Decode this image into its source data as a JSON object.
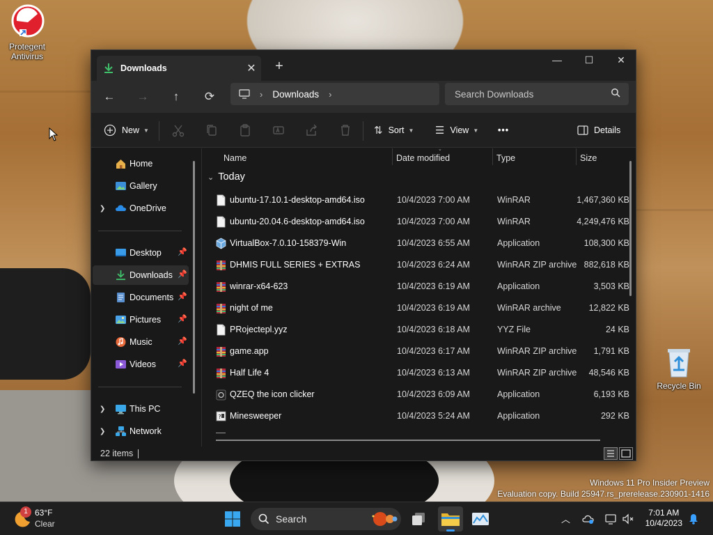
{
  "desktop": {
    "icons": [
      {
        "label": "Protegent Antivirus"
      },
      {
        "label": "Recycle Bin"
      }
    ],
    "watermark": {
      "line1": "Windows 11 Pro Insider Preview",
      "line2": "Evaluation copy. Build 25947.rs_prerelease.230901-1416"
    }
  },
  "explorer": {
    "tab_title": "Downloads",
    "window_controls": {
      "minimize": "—",
      "maximize": "☐",
      "close": "✕"
    },
    "address": {
      "root_icon": "monitor-icon",
      "location": "Downloads"
    },
    "search_placeholder": "Search Downloads",
    "toolbar": {
      "new_label": "New",
      "sort_label": "Sort",
      "view_label": "View",
      "more_label": "•••",
      "details_label": "Details"
    },
    "sidebar": {
      "home": "Home",
      "gallery": "Gallery",
      "onedrive": "OneDrive",
      "desktop": "Desktop",
      "downloads": "Downloads",
      "documents": "Documents",
      "pictures": "Pictures",
      "music": "Music",
      "videos": "Videos",
      "thispc": "This PC",
      "network": "Network"
    },
    "columns": {
      "name": "Name",
      "date": "Date modified",
      "type": "Type",
      "size": "Size"
    },
    "group_label": "Today",
    "files": [
      {
        "name": "ubuntu-17.10.1-desktop-amd64.iso",
        "date": "10/4/2023 7:00 AM",
        "type": "WinRAR",
        "size": "1,467,360 KB",
        "icon": "file-icon"
      },
      {
        "name": "ubuntu-20.04.6-desktop-amd64.iso",
        "date": "10/4/2023 7:00 AM",
        "type": "WinRAR",
        "size": "4,249,476 KB",
        "icon": "file-icon"
      },
      {
        "name": "VirtualBox-7.0.10-158379-Win",
        "date": "10/4/2023 6:55 AM",
        "type": "Application",
        "size": "108,300 KB",
        "icon": "virtualbox-icon"
      },
      {
        "name": "DHMIS FULL SERIES + EXTRAS",
        "date": "10/4/2023 6:24 AM",
        "type": "WinRAR ZIP archive",
        "size": "882,618 KB",
        "icon": "winrar-icon"
      },
      {
        "name": "winrar-x64-623",
        "date": "10/4/2023 6:19 AM",
        "type": "Application",
        "size": "3,503 KB",
        "icon": "winrar-icon"
      },
      {
        "name": "night of me",
        "date": "10/4/2023 6:19 AM",
        "type": "WinRAR archive",
        "size": "12,822 KB",
        "icon": "winrar-icon"
      },
      {
        "name": "PRojectepl.yyz",
        "date": "10/4/2023 6:18 AM",
        "type": "YYZ File",
        "size": "24 KB",
        "icon": "file-icon"
      },
      {
        "name": "game.app",
        "date": "10/4/2023 6:17 AM",
        "type": "WinRAR ZIP archive",
        "size": "1,791 KB",
        "icon": "winrar-icon"
      },
      {
        "name": "Half Life 4",
        "date": "10/4/2023 6:13 AM",
        "type": "WinRAR ZIP archive",
        "size": "48,546 KB",
        "icon": "winrar-icon"
      },
      {
        "name": "QZEQ the icon clicker",
        "date": "10/4/2023 6:09 AM",
        "type": "Application",
        "size": "6,193 KB",
        "icon": "app-icon"
      },
      {
        "name": "Minesweeper",
        "date": "10/4/2023 5:24 AM",
        "type": "Application",
        "size": "292 KB",
        "icon": "minesweeper-icon"
      }
    ],
    "status_count": "22 items"
  },
  "taskbar": {
    "weather": {
      "temp": "63°F",
      "condition": "Clear",
      "badge": "1"
    },
    "search_label": "Search",
    "clock": {
      "time": "7:01 AM",
      "date": "10/4/2023"
    }
  },
  "colors": {
    "accent": "#3aa0ff",
    "folder_green": "#3fbf6a",
    "winrar_red": "#b5283c"
  }
}
